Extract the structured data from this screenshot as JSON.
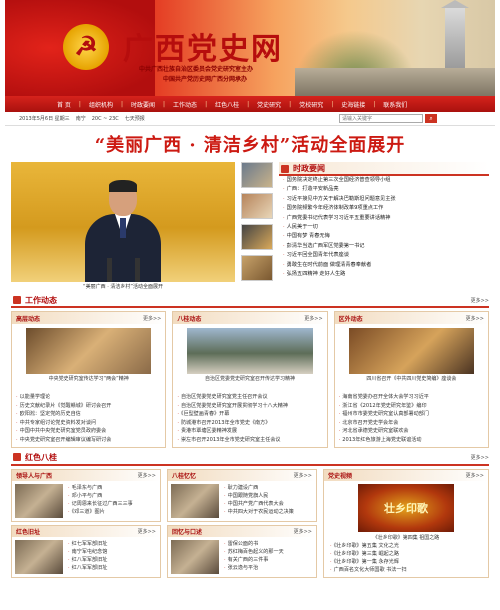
{
  "header": {
    "emblem_glyph": "☭",
    "site_title": "广西党史网",
    "sponsor_line1": "中共广西壮族自治区委员会党史研究室主办",
    "sponsor_line2": "中国共产党历史网广西分网承办"
  },
  "nav": [
    "首 页",
    "组织机构",
    "时政要闻",
    "工作动态",
    "红色八桂",
    "党史研究",
    "党校研究",
    "史海链接",
    "联系我们"
  ],
  "infobar": {
    "date": "2013年5月6日 星期三",
    "city": "南宁",
    "temp": "20C ~ 23C",
    "forecast": "七天预报",
    "search_placeholder": "请输入关键字",
    "search_go": "⌕"
  },
  "headline": "“美丽广西 · 清洁乡村”活动全面展开",
  "feature": {
    "caption": "“美丽广西 · 清洁乡村”活动全面展开"
  },
  "political_news": {
    "title": "时政要闻",
    "items": [
      "国务院决定终止第三次全国经济普查领导小组",
      "广西：打造平安新品亮",
      "习近平接见中方关于解决巴勒斯坦问题意见主张",
      "国务院频繁今年经济体制改革9项重点工作",
      "广西党委书记代表学习习近平五重要讲话精神",
      "人民美于一切",
      "中国有梦 青春无悔",
      "彭清华当选广西军区党委第一书记",
      "习近平回全国青年代表座谈",
      "勇敢生在时代前面 做理清青春奉献者",
      "弘扬五四精神 走好人生路"
    ]
  },
  "work_section": {
    "title": "工作动态",
    "more": "更多>>"
  },
  "columns": [
    {
      "title": "高层动态",
      "more": "更多>>",
      "caption": "中央党史研究室传达学习“两会”精神",
      "items": [
        "以能量学理论",
        "历史文献纪录片《觉醒赣城》研讨会召开",
        "欧阳淞：坚定党的历史自信",
        "中共专家组讨论党史资料发对谈问",
        "中国中共中央党史研究室党员政府委会",
        "中央党史研究室召开编辑审议编写研讨会"
      ]
    },
    {
      "title": "八桂动态",
      "more": "更多>>",
      "caption": "自治区党委党史研究室召开传达学习精神",
      "items": [
        "自治区党委党史研究室党主任召开会议",
        "自治区党委党史研究室开展贯彻学习十八大精神",
        "《巨型壁画青春》开幕",
        "防城港市召开2013年全市党史《南方》",
        "贵港市覃塘区委精神发展",
        "崇左市召开2013年全市党史研究室主任会议"
      ]
    },
    {
      "title": "区外动态",
      "more": "更多>>",
      "caption": "四川省召开《中共四川党史简编》座谈会",
      "items": [
        "海南省党委办召开全体大会学习习近平",
        "浙江省《2012年党史研究年鉴》编印",
        "福州市市委党史研究室认真部署动部门",
        "北京市召开党史学会年会",
        "河北省承德党史研究室联欢会",
        "2013年红色旅游上海党史联谊活动"
      ]
    }
  ],
  "red_section": {
    "title": "红色八桂",
    "more": "更多>>"
  },
  "bottom_cols": [
    {
      "title": "领导人与广西",
      "more": "更多>>",
      "items": [
        "毛泽东与广西",
        "邓小平与广西",
        "记周恩来长征过广西三三事",
        "《邓三道》图片"
      ]
    },
    {
      "title": "八桂忆忆",
      "more": "更多>>",
      "items": [
        "耿力建设广西",
        "中国跟随党旗人民",
        "中国共产党广西代表大会",
        "中共四大对于农民运动之决策"
      ]
    },
    {
      "title": "党史视频",
      "more": "更多>>",
      "video_text": "壮乡印歌",
      "video_caption": "《壮乡印歌》第四集 祖国之路",
      "items": [
        "《壮乡印歌》第五集 文化之光",
        "《壮乡印歌》第三集 崛起之路",
        "《壮乡印歌》第一集 永存光辉",
        "广西百名文化大师国歌 书法一扫"
      ]
    }
  ],
  "bottom_cols2": [
    {
      "title": "红色旧址",
      "more": "更多>>",
      "items": [
        "红七军军部旧址",
        "南宁军屯纪念馆",
        "红八军军部旧址",
        "红八军军部旧址"
      ]
    },
    {
      "title": "回忆与口述",
      "more": "更多>>",
      "items": [
        "雷保公面的书",
        "苏红梅百色起义的那一天",
        "有关广西的三件事",
        "张云逸与平治"
      ]
    }
  ]
}
